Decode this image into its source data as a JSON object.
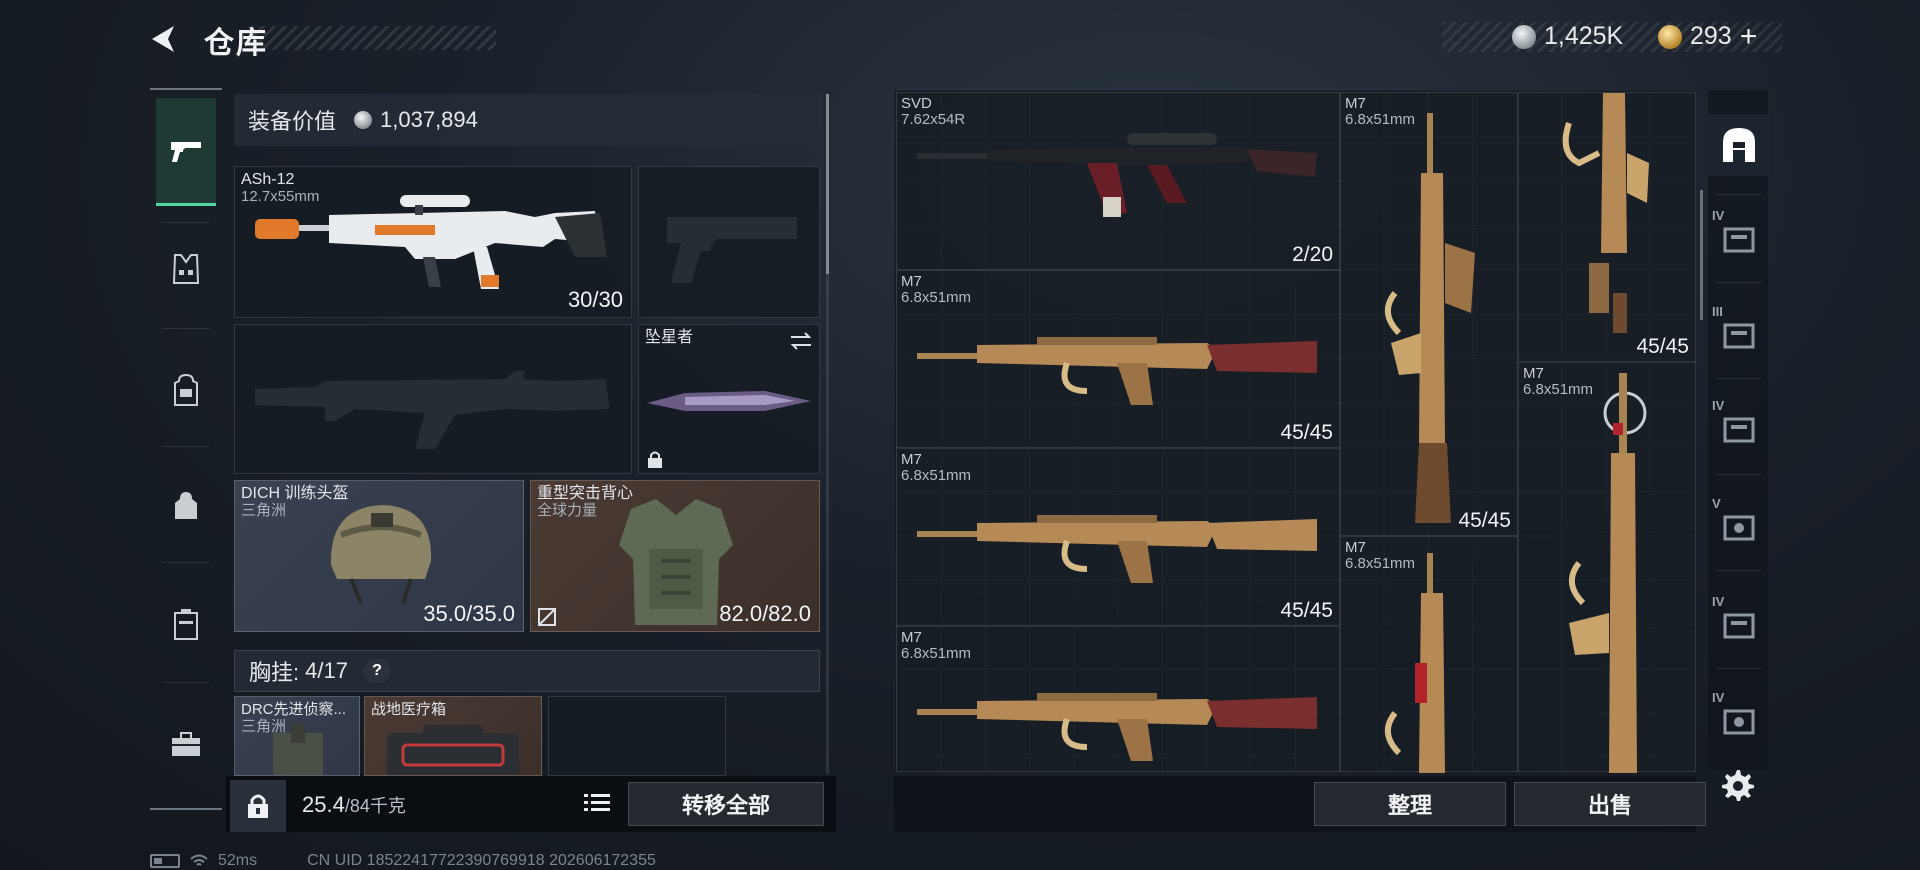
{
  "header": {
    "title": "仓库"
  },
  "currency": {
    "silver": "1,425K",
    "gold": "293",
    "plus": "+"
  },
  "left_rail": [
    "pistol-icon",
    "vest-icon",
    "backpack-icon",
    "pouch-icon",
    "case-icon",
    "toolbox-icon"
  ],
  "equipment": {
    "value_label": "装备价值",
    "value": "1,037,894",
    "primary": {
      "name": "ASh-12",
      "caliber": "12.7x55mm",
      "ammo": "30/30"
    },
    "melee": {
      "name": "坠星者"
    },
    "helmet": {
      "name": "DICH 训练头盔",
      "sub": "三角洲",
      "durability": "35.0/35.0"
    },
    "armor": {
      "name": "重型突击背心",
      "sub": "全球力量",
      "durability": "82.0/82.0"
    },
    "chest_rig": {
      "label": "胸挂:",
      "count": "4/17",
      "help": "?"
    },
    "chest_items": [
      {
        "name": "DRC先进侦察...",
        "sub": "三角洲"
      },
      {
        "name": "战地医疗箱",
        "sub": ""
      }
    ],
    "weight": "25.4",
    "weight_max": "/84千克",
    "transfer_all": "转移全部"
  },
  "storage": {
    "items": [
      {
        "name": "SVD",
        "caliber": "7.62x54R",
        "ammo": "2/20"
      },
      {
        "name": "M7",
        "caliber": "6.8x51mm",
        "ammo": "45/45"
      },
      {
        "name": "M7",
        "caliber": "6.8x51mm",
        "ammo": "45/45"
      },
      {
        "name": "M7",
        "caliber": "6.8x51mm",
        "ammo": ""
      },
      {
        "name": "M7",
        "caliber": "6.8x51mm",
        "ammo": "45/45"
      },
      {
        "name": "M7",
        "caliber": "6.8x51mm",
        "ammo": ""
      },
      {
        "name": "",
        "caliber": "",
        "ammo": "45/45"
      },
      {
        "name": "M7",
        "caliber": "6.8x51mm",
        "ammo": ""
      }
    ],
    "sort_label": "整理",
    "sell_label": "出售"
  },
  "right_rail": [
    {
      "icon": "warehouse-home-icon",
      "tier": ""
    },
    {
      "icon": "storage-tab-icon",
      "tier": "IV"
    },
    {
      "icon": "storage-tab-icon",
      "tier": "III"
    },
    {
      "icon": "storage-tab-icon",
      "tier": "IV"
    },
    {
      "icon": "storage-tab-icon",
      "tier": "V"
    },
    {
      "icon": "storage-tab-icon",
      "tier": "IV"
    },
    {
      "icon": "storage-tab-icon",
      "tier": "IV"
    }
  ],
  "status": {
    "ping": "52ms",
    "uid": "CN UID 18522417722390769918  202606172355"
  },
  "colors": {
    "accent_green": "#52d6a4",
    "gold": "#c8a15a"
  }
}
